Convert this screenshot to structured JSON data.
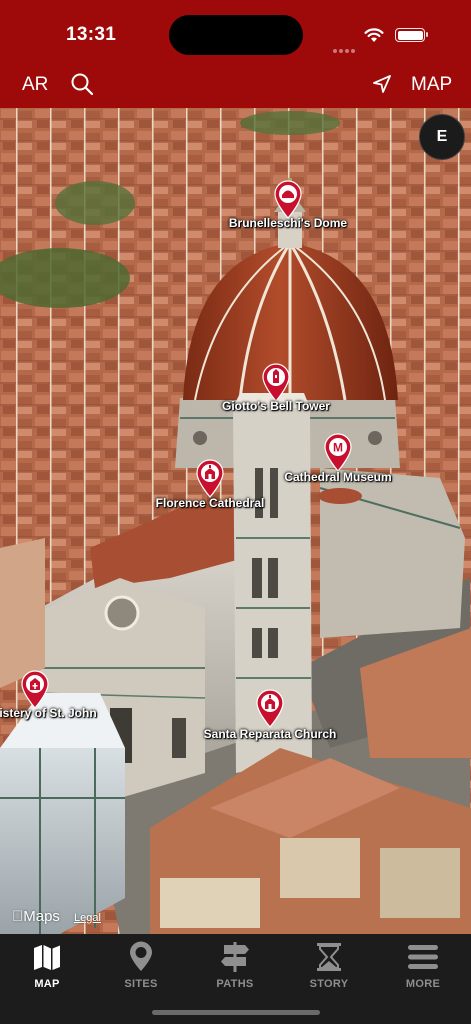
{
  "theme": {
    "accent": "#9e0a0a",
    "pin_color": "#c8102e"
  },
  "status_bar": {
    "time": "13:31"
  },
  "header": {
    "ar_label": "AR",
    "map_label": "MAP"
  },
  "compass": {
    "heading_letter": "E"
  },
  "map": {
    "pins": [
      {
        "label": "Brunelleschi's Dome",
        "icon": "dome-icon"
      },
      {
        "label": "Giotto's Bell Tower",
        "icon": "bell-tower-icon"
      },
      {
        "label": "Cathedral Museum",
        "icon": "museum-icon"
      },
      {
        "label": "Florence Cathedral",
        "icon": "church-icon"
      },
      {
        "label": "istery of St. John",
        "icon": "baptistery-icon"
      },
      {
        "label": "Santa Reparata Church",
        "icon": "church-icon"
      }
    ],
    "brand": "Maps",
    "legal": "Legal"
  },
  "tabs": [
    {
      "label": "MAP",
      "icon": "map-icon",
      "active": true
    },
    {
      "label": "SITES",
      "icon": "location-pin-icon",
      "active": false
    },
    {
      "label": "PATHS",
      "icon": "signpost-icon",
      "active": false
    },
    {
      "label": "STORY",
      "icon": "hourglass-icon",
      "active": false
    },
    {
      "label": "MORE",
      "icon": "menu-icon",
      "active": false
    }
  ]
}
